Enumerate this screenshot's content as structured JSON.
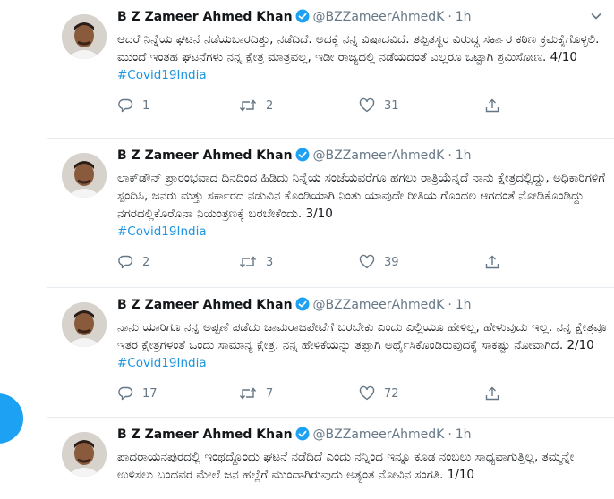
{
  "tweets": [
    {
      "name": "B Z Zameer Ahmed Khan",
      "handle": "@BZZameerAhmedK",
      "dot": "·",
      "time": "1h",
      "text": "ಆದರೆ ನಿನ್ನೆಯ ಘಟನೆ ನಡೆಯಬಾರದಿತ್ತು, ನಡೆದಿದೆ. ಅದಕ್ಕೆ ನನ್ನ ವಿಷಾದವಿದೆ. ತಪ್ಪಿತಸ್ಥರ ವಿರುದ್ಧ ಸರ್ಕಾರ ಕಠಿಣ ಕ್ರಮಕೈಗೊಳ್ಳಲಿ. ಮುಂದೆ ಇಂತಹ ಘಟನೆಗಳು ನನ್ನ ಕ್ಷೇತ್ರ ಮಾತ್ರವಲ್ಲ, ಇಡೀ ರಾಜ್ಯದಲ್ಲಿ ನಡೆಯದಂತೆ ಎಲ್ಲರೂ ಒಟ್ಟಾಗಿ ಶ್ರಮಿಸೋಣ. 4/10",
      "hashtag": "#Covid19India",
      "replies": "1",
      "retweets": "2",
      "likes": "31"
    },
    {
      "name": "B Z Zameer Ahmed Khan",
      "handle": "@BZZameerAhmedK",
      "dot": "·",
      "time": "1h",
      "text": "ಲಾಕ್‌ಡೌನ್ ಪ್ರಾರಂಭವಾದ ದಿನದಿಂದ ಹಿಡಿದು ನಿನ್ನೆಯ ಸಂಜೆಯವರೆಗೂ ಹಗಲು ರಾತ್ರಿಯೆನ್ನದೆ ನಾನು ಕ್ಷೇತ್ರದಲ್ಲಿದ್ದು, ಅಧಿಕಾರಿಗಳಿಗೆ ಸ್ಪಂದಿಸಿ, ಜನರು ಮತ್ತು ಸರ್ಕಾರದ ನಡುವಿನ ಕೊಂಡಿಯಾಗಿ ನಿಂತು ಯಾವುದೇ ರೀತಿಯ ಗೊಂದಲ ಆಗದಂತೆ ನೋಡಿಕೊಂಡಿದ್ದು ನಗರದಲ್ಲಿಕೊರೊನಾ ನಿಯಂತ್ರಣಕ್ಕೆ ಬರಬೇಕೆಂದು. 3/10",
      "hashtag": "#Covid19India",
      "replies": "2",
      "retweets": "3",
      "likes": "39"
    },
    {
      "name": "B Z Zameer Ahmed Khan",
      "handle": "@BZZameerAhmedK",
      "dot": "·",
      "time": "1h",
      "text": "ನಾನು ಯಾರಿಗೂ ನನ್ನ ಅಪ್ಪಣೆ ಪಡೆದು ಚಾಮರಾಜಪೇಟೆಗೆ ಬರಬೇಕು ಎಂದು ಎಲ್ಲಿಯೂ ಹೇಳಿಲ್ಲ, ಹೇಳುವುದು ಇಲ್ಲ. ನನ್ನ ಕ್ಷೇತ್ರವೂ ಇತರ ಕ್ಷೇತ್ರಗಳಂತೆ ಒಂದು ಸಾಮಾನ್ಯ ಕ್ಷೇತ್ರ. ನನ್ನ ಹೇಳಿಕೆಯನ್ನು ತಪ್ಪಾಗಿ ಅರ್ಥೈಸಿಕೊಂಡಿರುವುದಕ್ಕೆ ಸಾಕಷ್ಟು ನೋವಾಗಿದೆ. 2/10",
      "hashtag": "#Covid19India",
      "replies": "17",
      "retweets": "7",
      "likes": "72"
    },
    {
      "name": "B Z Zameer Ahmed Khan",
      "handle": "@BZZameerAhmedK",
      "dot": "·",
      "time": "1h",
      "text": "ಪಾದರಾಯನಪುರದಲ್ಲಿ ಇಂಥದ್ದೊಂದು ಘಟನೆ ನಡೆದಿದೆ ಎಂದು ನನ್ನಿಂದ ಇನ್ನೂ ಕೂಡ ನಂಬಲು ಸಾಧ್ಯವಾಗುತ್ತಿಲ್ಲ, ತಮ್ಮನ್ನೇ ಉಳಿಸಲು ಬಂದವರ ಮೇಲೆ ಜನ ಹಲ್ಲೆಗೆ ಮುಂದಾಗಿರುವುದು ಅತ್ಯಂತ ನೋವಿನ ಸಂಗತಿ. 1/10",
      "hashtag": "",
      "replies": "",
      "retweets": "",
      "likes": ""
    }
  ],
  "icons": {
    "verified": "verified-badge-icon",
    "caret": "chevron-down-icon",
    "reply": "reply-icon",
    "retweet": "retweet-icon",
    "like": "heart-icon",
    "share": "share-icon"
  },
  "colors": {
    "link": "#1b95e0",
    "verified": "#1da1f2",
    "muted": "#657786",
    "fab": "#1da1f2"
  }
}
